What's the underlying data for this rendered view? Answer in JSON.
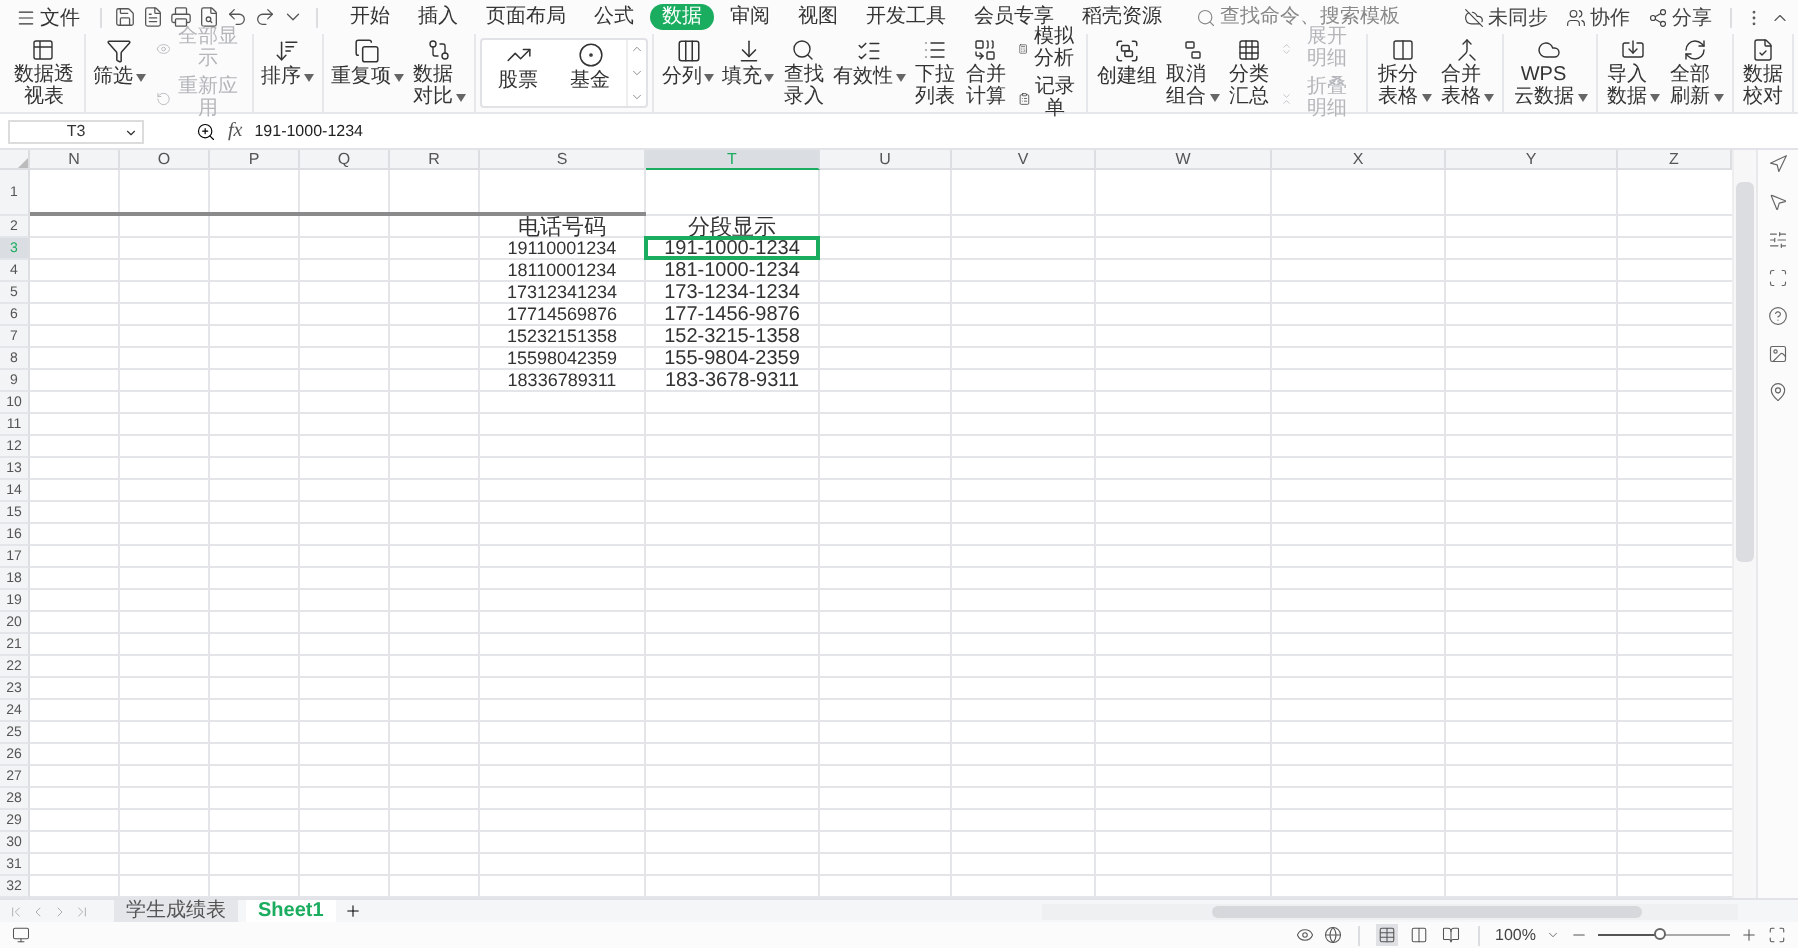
{
  "menu_bar": {
    "file_menu": "文件",
    "tabs": [
      {
        "label": "开始",
        "selected": false
      },
      {
        "label": "插入",
        "selected": false
      },
      {
        "label": "页面布局",
        "selected": false
      },
      {
        "label": "公式",
        "selected": false
      },
      {
        "label": "数据",
        "selected": true
      },
      {
        "label": "审阅",
        "selected": false
      },
      {
        "label": "视图",
        "selected": false
      },
      {
        "label": "开发工具",
        "selected": false
      },
      {
        "label": "会员专享",
        "selected": false
      },
      {
        "label": "稻壳资源",
        "selected": false
      }
    ],
    "search": {
      "placeholder": "查找命令、搜索模板"
    },
    "actions": [
      "未同步",
      "协作",
      "分享"
    ]
  },
  "ribbon": {
    "groups": [
      {
        "items": [
          {
            "kind": "large",
            "label": "数据透视表",
            "dropdown": false
          }
        ]
      },
      {
        "items": [
          {
            "kind": "large",
            "label": "筛选",
            "dropdown": true
          },
          {
            "kind": "stack",
            "items": [
              {
                "label": "全部显示",
                "disabled": true
              },
              {
                "label": "重新应用",
                "disabled": true
              }
            ]
          }
        ]
      },
      {
        "items": [
          {
            "kind": "large",
            "label": "排序",
            "dropdown": true
          }
        ]
      },
      {
        "items": [
          {
            "kind": "large",
            "label": "重复项",
            "dropdown": true
          },
          {
            "kind": "large",
            "label": "数据对比",
            "dropdown": true
          }
        ]
      },
      {
        "items": [
          {
            "kind": "gallery",
            "items": [
              {
                "label": "股票"
              },
              {
                "label": "基金"
              }
            ]
          }
        ]
      },
      {
        "items": [
          {
            "kind": "large",
            "label": "分列",
            "dropdown": true
          },
          {
            "kind": "large",
            "label": "填充",
            "dropdown": true
          },
          {
            "kind": "large",
            "label": "查找录入",
            "dropdown": false
          },
          {
            "kind": "large",
            "label": "有效性",
            "dropdown": true
          },
          {
            "kind": "large",
            "label": "下拉列表",
            "dropdown": false
          },
          {
            "kind": "large",
            "label": "合并计算",
            "dropdown": false
          },
          {
            "kind": "stack",
            "items": [
              {
                "label": "模拟分析",
                "disabled": false
              },
              {
                "label": "记录单",
                "disabled": false
              }
            ]
          }
        ]
      },
      {
        "items": [
          {
            "kind": "large",
            "label": "创建组",
            "dropdown": false
          },
          {
            "kind": "large",
            "label": "取消组合",
            "dropdown": true
          },
          {
            "kind": "large",
            "label": "分类汇总",
            "dropdown": false
          },
          {
            "kind": "stack",
            "items": [
              {
                "label": "展开明细",
                "disabled": true
              },
              {
                "label": "折叠明细",
                "disabled": true
              }
            ]
          }
        ]
      },
      {
        "items": [
          {
            "kind": "large",
            "label": "拆分表格",
            "dropdown": true
          },
          {
            "kind": "large",
            "label": "合并表格",
            "dropdown": true
          }
        ]
      },
      {
        "items": [
          {
            "kind": "large",
            "label": "WPS云数据",
            "dropdown": true
          }
        ]
      },
      {
        "items": [
          {
            "kind": "large",
            "label": "导入数据",
            "dropdown": true
          },
          {
            "kind": "large",
            "label": "全部刷新",
            "dropdown": true
          }
        ]
      },
      {
        "items": [
          {
            "kind": "large",
            "label": "数据校对",
            "dropdown": false
          }
        ]
      }
    ]
  },
  "formula_bar": {
    "name_box": "T3",
    "function_label": "fx",
    "formula": "191-1000-1234"
  },
  "sheet": {
    "columns": [
      {
        "label": "N",
        "selected": false
      },
      {
        "label": "O",
        "selected": false
      },
      {
        "label": "P",
        "selected": false
      },
      {
        "label": "Q",
        "selected": false
      },
      {
        "label": "R",
        "selected": false
      },
      {
        "label": "S",
        "selected": false
      },
      {
        "label": "T",
        "selected": true
      },
      {
        "label": "U",
        "selected": false
      },
      {
        "label": "V",
        "selected": false
      },
      {
        "label": "W",
        "selected": false
      },
      {
        "label": "X",
        "selected": false
      },
      {
        "label": "Y",
        "selected": false
      },
      {
        "label": "Z",
        "selected": false
      }
    ],
    "rows": [
      {
        "label": "1",
        "selected": false
      },
      {
        "label": "2",
        "selected": false,
        "column_S": "电话号码",
        "column_T": "分段显示"
      },
      {
        "label": "3",
        "selected": true,
        "column_S": "19110001234",
        "column_T": "191-1000-1234"
      },
      {
        "label": "4",
        "selected": false,
        "column_S": "18110001234",
        "column_T": "181-1000-1234"
      },
      {
        "label": "5",
        "selected": false,
        "column_S": "17312341234",
        "column_T": "173-1234-1234"
      },
      {
        "label": "6",
        "selected": false,
        "column_S": "17714569876",
        "column_T": "177-1456-9876"
      },
      {
        "label": "7",
        "selected": false,
        "column_S": "15232151358",
        "column_T": "152-3215-1358"
      },
      {
        "label": "8",
        "selected": false,
        "column_S": "15598042359",
        "column_T": "155-9804-2359"
      },
      {
        "label": "9",
        "selected": false,
        "column_S": "18336789311",
        "column_T": "183-3678-9311"
      },
      {
        "label": "10",
        "selected": false
      },
      {
        "label": "11",
        "selected": false
      },
      {
        "label": "12",
        "selected": false
      },
      {
        "label": "13",
        "selected": false
      },
      {
        "label": "14",
        "selected": false
      },
      {
        "label": "15",
        "selected": false
      },
      {
        "label": "16",
        "selected": false
      },
      {
        "label": "17",
        "selected": false
      },
      {
        "label": "18",
        "selected": false
      },
      {
        "label": "19",
        "selected": false
      },
      {
        "label": "20",
        "selected": false
      },
      {
        "label": "21",
        "selected": false
      },
      {
        "label": "22",
        "selected": false
      },
      {
        "label": "23",
        "selected": false
      },
      {
        "label": "24",
        "selected": false
      },
      {
        "label": "25",
        "selected": false
      },
      {
        "label": "26",
        "selected": false
      },
      {
        "label": "27",
        "selected": false
      },
      {
        "label": "28",
        "selected": false
      },
      {
        "label": "29",
        "selected": false
      },
      {
        "label": "30",
        "selected": false
      },
      {
        "label": "31",
        "selected": false
      },
      {
        "label": "32",
        "selected": false
      }
    ]
  },
  "sheet_tabs": [
    {
      "label": "学生成绩表",
      "selected": false
    },
    {
      "label": "Sheet1",
      "selected": true
    }
  ],
  "status_bar": {
    "view_modes": [
      {
        "selected": true
      },
      {
        "selected": false
      },
      {
        "selected": false
      }
    ],
    "zoom": "100%",
    "zoom_slider": {
      "level": 0.47
    }
  }
}
